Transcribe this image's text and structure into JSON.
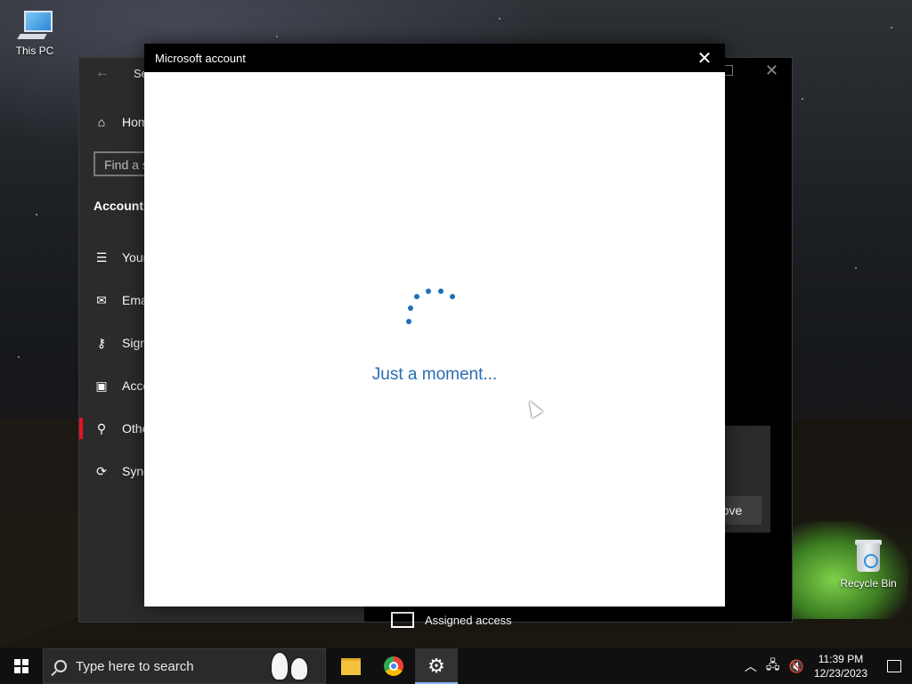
{
  "desktop": {
    "icons": [
      {
        "label": "This PC"
      },
      {
        "label": "Recycle Bin"
      }
    ]
  },
  "settings": {
    "title": "Se",
    "search_placeholder": "Find a s",
    "section_heading": "Accounts",
    "nav": [
      {
        "label": "Hom",
        "icon": "home-icon"
      },
      {
        "label": "Your",
        "icon": "person-card-icon"
      },
      {
        "label": "Ema",
        "icon": "mail-icon"
      },
      {
        "label": "Sign",
        "icon": "key-icon"
      },
      {
        "label": "Acce",
        "icon": "briefcase-icon"
      },
      {
        "label": "Othe",
        "icon": "person-add-icon"
      },
      {
        "label": "Sync",
        "icon": "sync-icon"
      }
    ],
    "remove_label": "ove",
    "assigned_label": "Assigned access"
  },
  "dialog": {
    "title": "Microsoft account",
    "status": "Just a moment..."
  },
  "taskbar": {
    "search_placeholder": "Type here to search",
    "time": "11:39 PM",
    "date": "12/23/2023"
  },
  "colors": {
    "accent_red": "#e81123",
    "link_blue": "#2a6db3"
  }
}
